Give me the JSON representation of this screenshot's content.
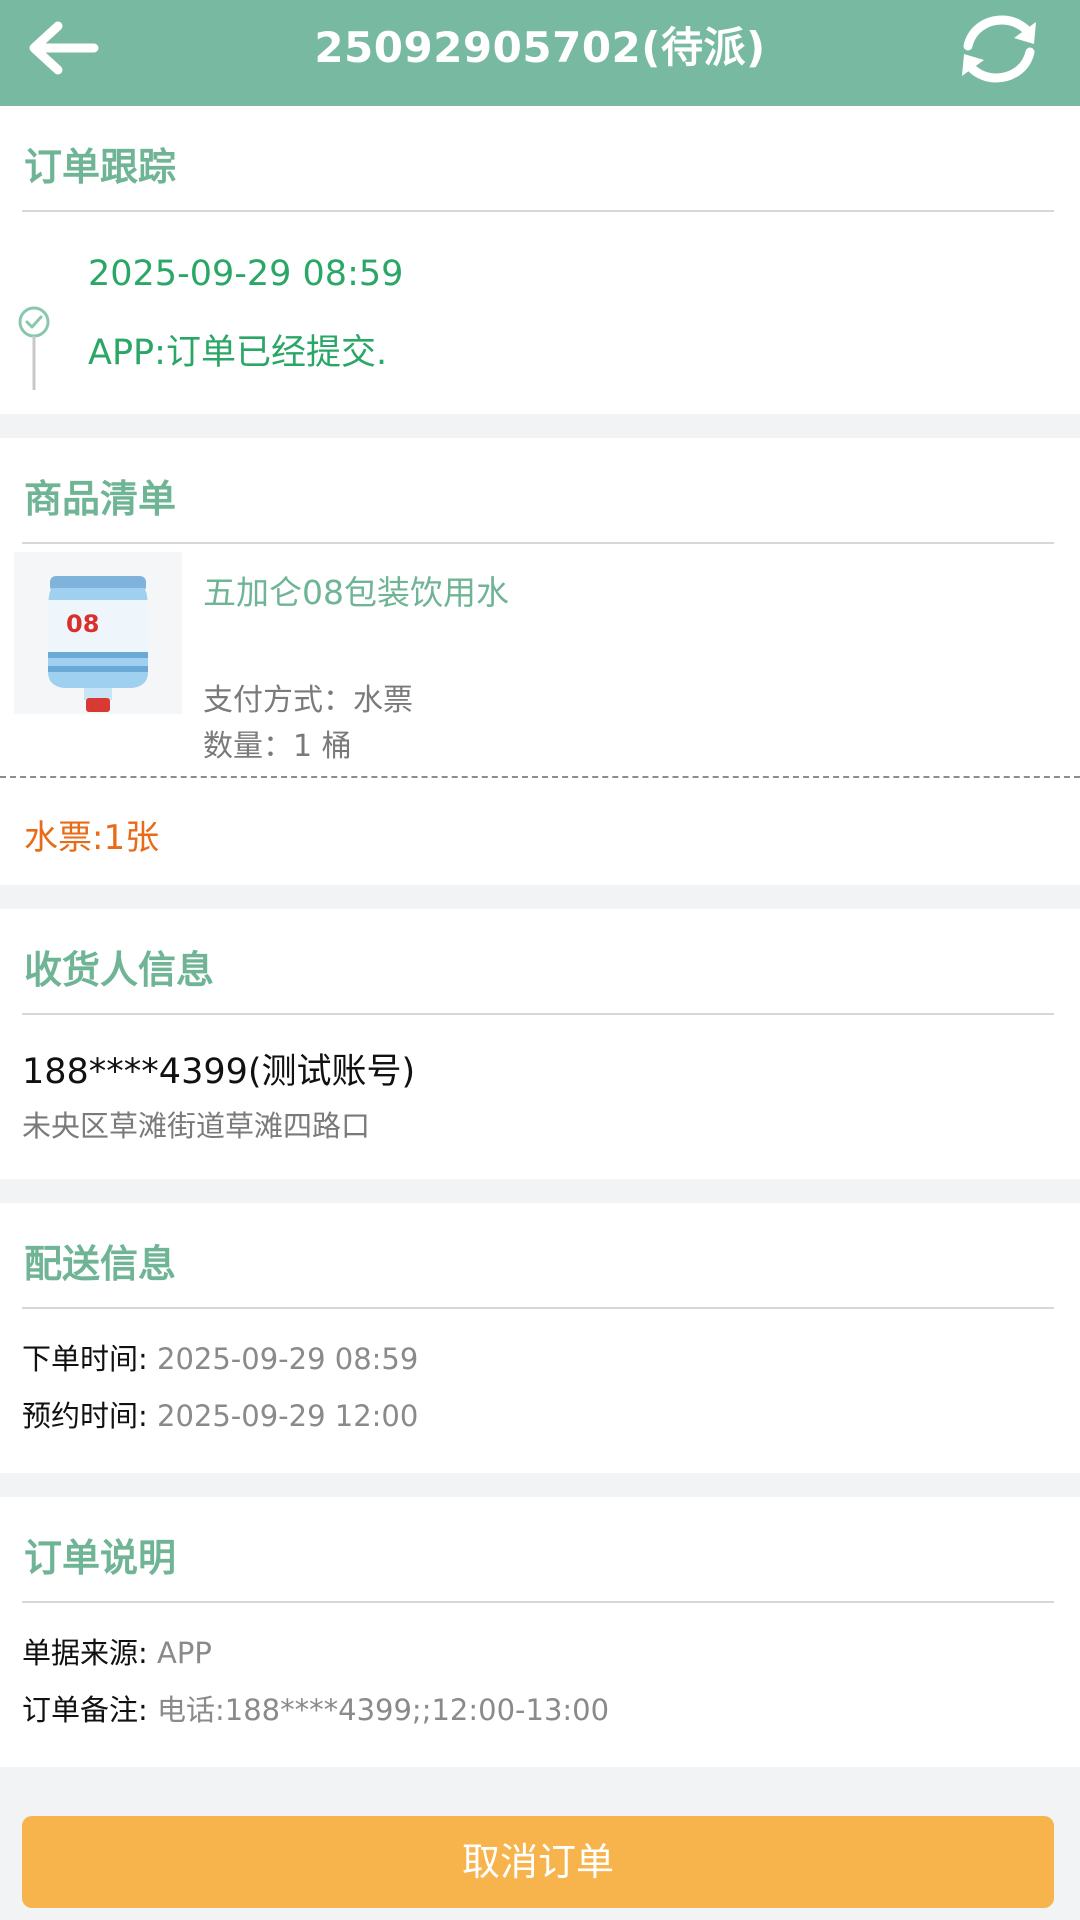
{
  "header": {
    "title": "25092905702(待派)",
    "back_icon": "arrow-left-icon",
    "refresh_icon": "refresh-icon"
  },
  "tracking": {
    "section_title": "订单跟踪",
    "events": [
      {
        "time": "2025-09-29 08:59",
        "message": "APP:订单已经提交."
      }
    ],
    "status_icon": "check-circle-icon"
  },
  "products": {
    "section_title": "商品清单",
    "items": [
      {
        "name": "五加仑08包装饮用水",
        "payment": "支付方式：水票",
        "quantity": "数量：1 桶",
        "image_icon": "water-bucket-image"
      }
    ],
    "ticket_summary": "水票:1张"
  },
  "consignee": {
    "section_title": "收货人信息",
    "phone": "188****4399(测试账号)",
    "address": "未央区草滩街道草滩四路口"
  },
  "delivery": {
    "section_title": "配送信息",
    "order_time_label": "下单时间:",
    "order_time": " 2025-09-29 08:59",
    "appointment_label": "预约时间:",
    "appointment_time": " 2025-09-29 12:00"
  },
  "notes": {
    "section_title": "订单说明",
    "source_label": "单据来源:",
    "source_value": " APP",
    "remark_label": "订单备注:",
    "remark_value": " 电话:188****4399;;12:00-13:00"
  },
  "actions": {
    "cancel_label": "取消订单"
  },
  "colors": {
    "header": "#78b9a2",
    "section_title": "#6fb495",
    "tracking_text": "#2aa766",
    "ticket_text": "#e86b17",
    "cancel_button": "#f7b34c",
    "page_background": "#f2f3f4"
  }
}
